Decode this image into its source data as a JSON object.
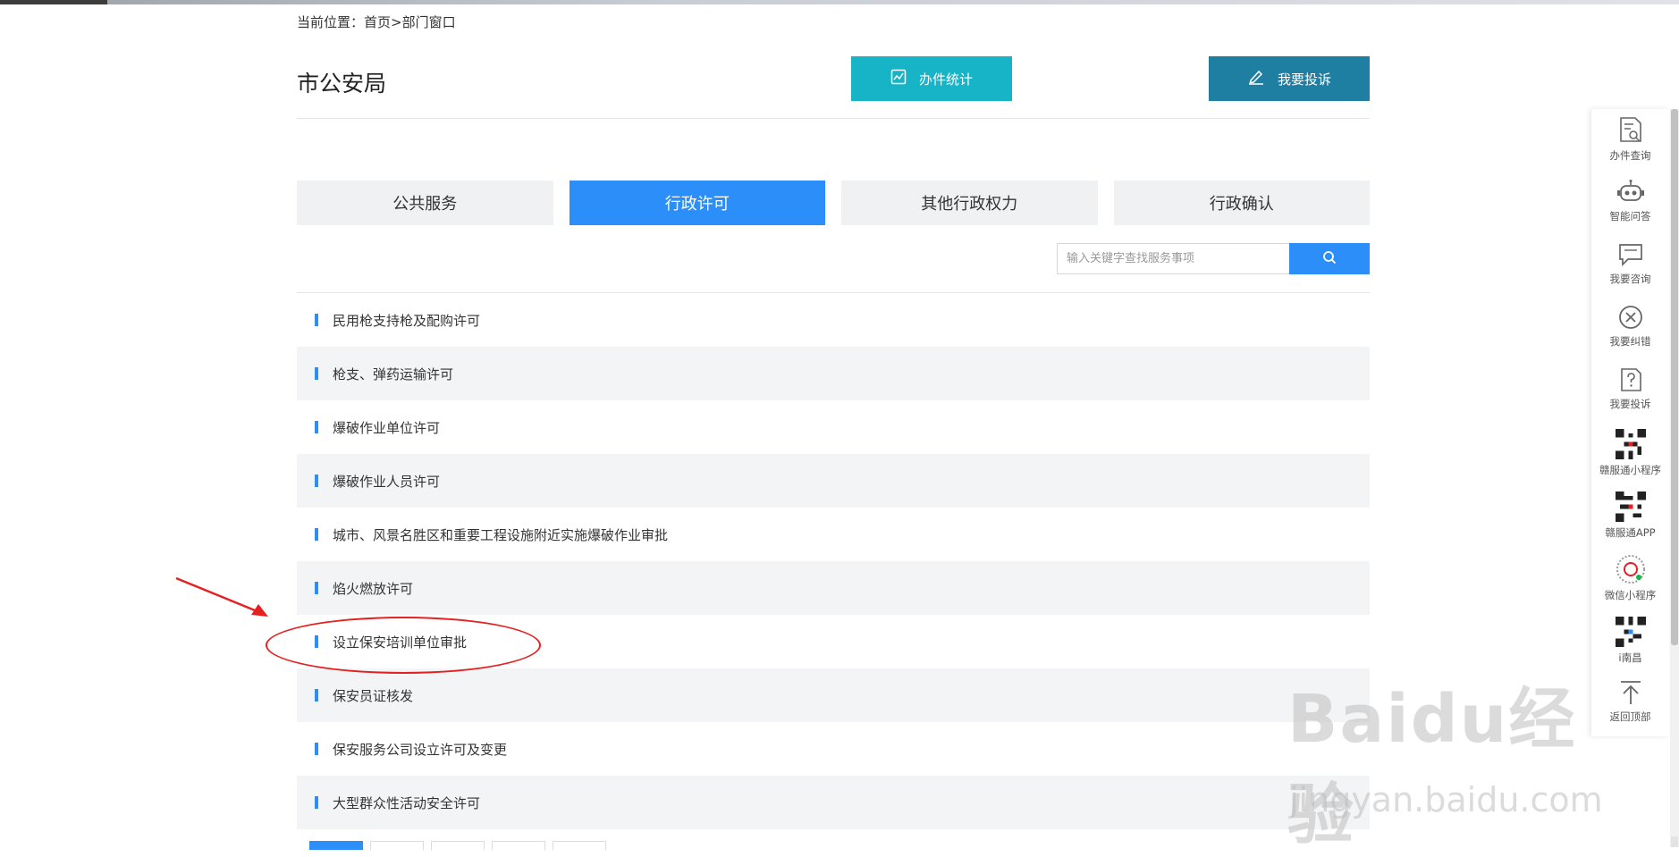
{
  "breadcrumb": {
    "prefix": "当前位置：",
    "home": "首页",
    "sep": ">",
    "current": "部门窗口"
  },
  "dept_title": "市公安局",
  "buttons": {
    "stat": "办件统计",
    "complain": "我要投诉"
  },
  "tabs": [
    {
      "label": "公共服务",
      "active": false
    },
    {
      "label": "行政许可",
      "active": true
    },
    {
      "label": "其他行政权力",
      "active": false
    },
    {
      "label": "行政确认",
      "active": false
    }
  ],
  "search": {
    "placeholder": "输入关键字查找服务事项",
    "value": ""
  },
  "items": [
    "民用枪支持枪及配购许可",
    "枪支、弹药运输许可",
    "爆破作业单位许可",
    "爆破作业人员许可",
    "城市、风景名胜区和重要工程设施附近实施爆破作业审批",
    "焰火燃放许可",
    "设立保安培训单位审批",
    "保安员证核发",
    "保安服务公司设立许可及变更",
    "大型群众性活动安全许可"
  ],
  "sidebar": [
    {
      "label": "办件查询",
      "icon": "document-search-icon"
    },
    {
      "label": "智能问答",
      "icon": "robot-icon"
    },
    {
      "label": "我要咨询",
      "icon": "chat-bubble-icon"
    },
    {
      "label": "我要纠错",
      "icon": "close-circle-icon"
    },
    {
      "label": "我要投诉",
      "icon": "question-document-icon"
    },
    {
      "label": "赣服通小程序",
      "icon": "qr-code-icon"
    },
    {
      "label": "赣服通APP",
      "icon": "qr-code-icon"
    },
    {
      "label": "微信小程序",
      "icon": "mini-program-code-icon"
    },
    {
      "label": "i南昌",
      "icon": "qr-code-icon"
    },
    {
      "label": "返回顶部",
      "icon": "back-to-top-icon"
    }
  ],
  "watermark": {
    "main": "Baidu经验",
    "sub": "jingyan.baidu.com"
  },
  "colors": {
    "accent": "#2c8ef8",
    "stat_button": "#17b3c6",
    "complain_button": "#1e7fa2",
    "annotation": "#e42020"
  }
}
